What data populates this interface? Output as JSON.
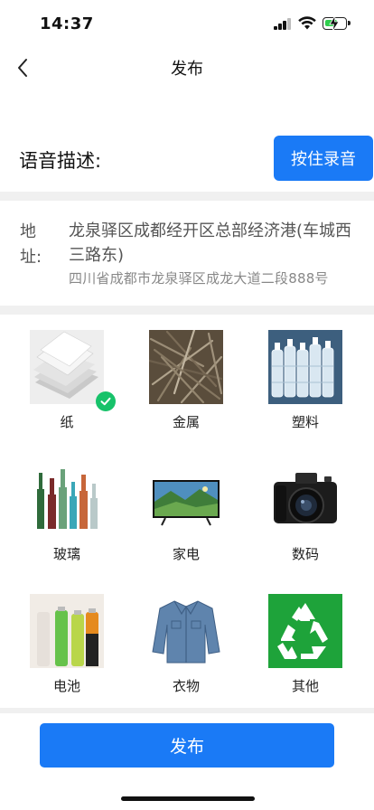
{
  "status_bar": {
    "time": "14:37"
  },
  "nav": {
    "title": "发布",
    "back_icon": "chevron-left-icon"
  },
  "voice": {
    "label": "语音描述:",
    "button": "按住录音"
  },
  "address": {
    "label_line1": "地",
    "label_line2": "址:",
    "main": "龙泉驿区成都经开区总部经济港(车城西三路东)",
    "detail": "四川省成都市龙泉驿区成龙大道二段888号"
  },
  "categories": [
    {
      "label": "纸",
      "icon": "paper-stack-image",
      "selected": true
    },
    {
      "label": "金属",
      "icon": "scrap-metal-image",
      "selected": false
    },
    {
      "label": "塑料",
      "icon": "plastic-bottles-image",
      "selected": false
    },
    {
      "label": "玻璃",
      "icon": "glass-bottles-image",
      "selected": false
    },
    {
      "label": "家电",
      "icon": "television-image",
      "selected": false
    },
    {
      "label": "数码",
      "icon": "camera-image",
      "selected": false
    },
    {
      "label": "电池",
      "icon": "batteries-image",
      "selected": false
    },
    {
      "label": "衣物",
      "icon": "denim-jacket-image",
      "selected": false
    },
    {
      "label": "其他",
      "icon": "recycle-symbol-image",
      "selected": false
    }
  ],
  "publish": {
    "label": "发布"
  },
  "colors": {
    "primary": "#1a7af6",
    "check_green": "#17c26a",
    "recycle_green": "#1ea33a"
  }
}
